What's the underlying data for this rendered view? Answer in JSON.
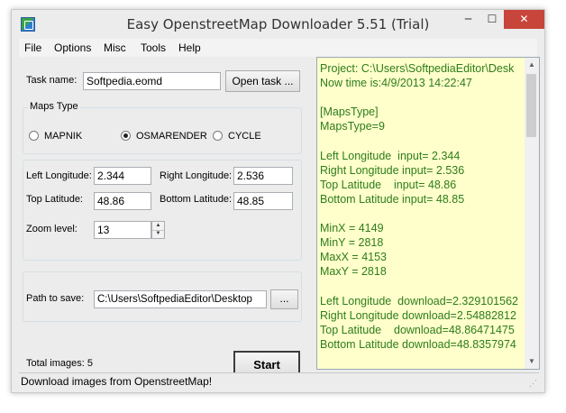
{
  "window": {
    "title": "Easy OpenstreetMap Downloader 5.51 (Trial)",
    "min": "─",
    "max": "☐",
    "close": "✕"
  },
  "menu": [
    "File",
    "Options",
    "Misc",
    "Tools",
    "Help"
  ],
  "task": {
    "label": "Task name:",
    "value": "Softpedia.eomd",
    "open_button": "Open task ..."
  },
  "maps_type": {
    "legend": "Maps Type",
    "options": [
      "MAPNIK",
      "OSMARENDER",
      "CYCLE"
    ],
    "selected": "OSMARENDER"
  },
  "coords": {
    "left_lon_label": "Left Longitude:",
    "left_lon_value": "2.344",
    "right_lon_label": "Right Longitude:",
    "right_lon_value": "2.536",
    "top_lat_label": "Top Latitude:",
    "top_lat_value": "48.86",
    "bottom_lat_label": "Bottom Latitude:",
    "bottom_lat_value": "48.85",
    "zoom_label": "Zoom level:",
    "zoom_value": "13"
  },
  "path": {
    "label": "Path to save:",
    "value": "C:\\Users\\SoftpediaEditor\\Desktop",
    "browse_button": "..."
  },
  "total_images": "Total images: 5",
  "start_button": "Start",
  "log": {
    "lines": [
      "Project: C:\\Users\\SoftpediaEditor\\Desk",
      "Now time is:4/9/2013 14:22:47",
      "",
      "[MapsType]",
      "MapsType=9",
      "",
      "Left Longitude  input= 2.344",
      "Right Longitude input= 2.536",
      "Top Latitude    input= 48.86",
      "Bottom Latitude input= 48.85",
      "",
      "MinX = 4149",
      "MinY = 2818",
      "MaxX = 4153",
      "MaxY = 2818",
      "",
      "Left Longitude  download=2.329101562",
      "Right Longitude download=2.54882812",
      "Top Latitude    download=48.86471475",
      "Bottom Latitude download=48.8357974"
    ]
  },
  "status": "Download images from OpenstreetMap!"
}
